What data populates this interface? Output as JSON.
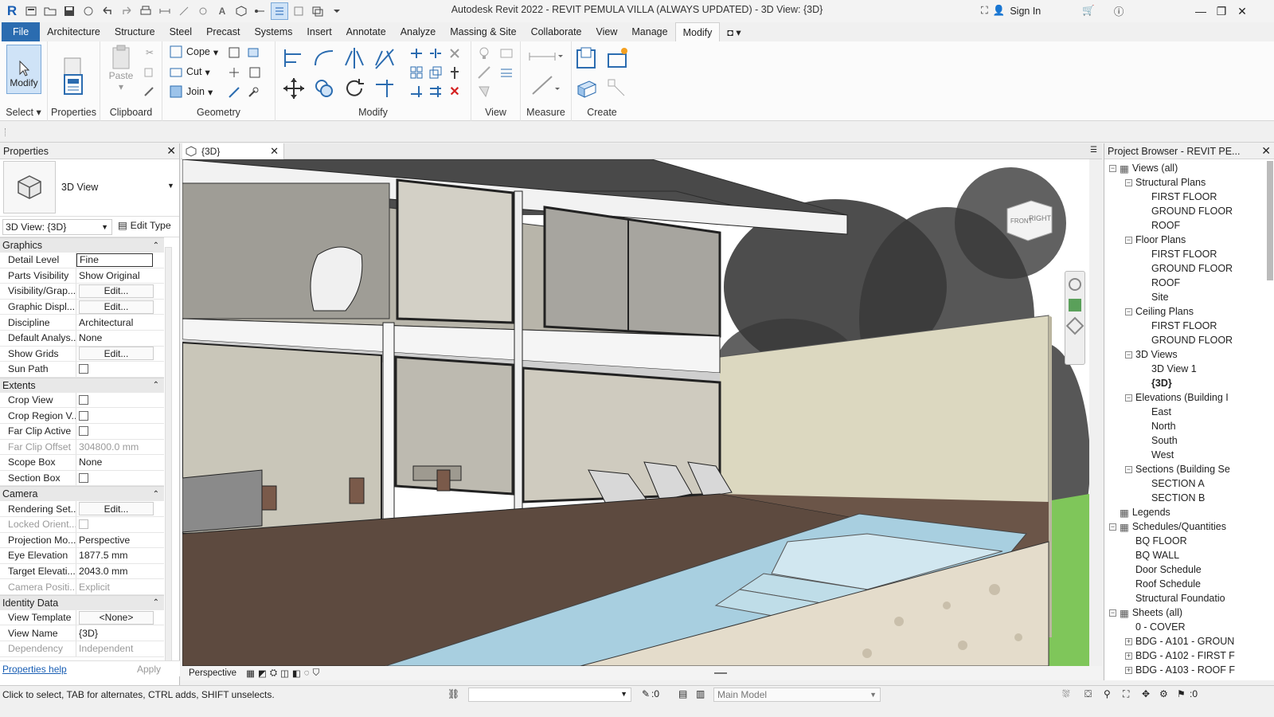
{
  "titlebar": {
    "app_title": "Autodesk Revit 2022 - REVIT PEMULA VILLA (ALWAYS UPDATED) - 3D View: {3D}",
    "sign_in": "Sign In"
  },
  "tabs": [
    "File",
    "Architecture",
    "Structure",
    "Steel",
    "Precast",
    "Systems",
    "Insert",
    "Annotate",
    "Analyze",
    "Massing & Site",
    "Collaborate",
    "View",
    "Manage",
    "Modify"
  ],
  "active_tab": "Modify",
  "ribbon": {
    "modify_label": "Modify",
    "select_label": "Select",
    "properties_label": "Properties",
    "clipboard_label": "Clipboard",
    "paste_label": "Paste",
    "geometry_label": "Geometry",
    "cope_label": "Cope",
    "cut_label": "Cut",
    "join_label": "Join",
    "modify_panel_label": "Modify",
    "view_label": "View",
    "measure_label": "Measure",
    "create_label": "Create"
  },
  "properties": {
    "title": "Properties",
    "type_name": "3D View",
    "view_selector": "3D View: {3D}",
    "edit_type": "Edit Type",
    "groups": [
      {
        "name": "Graphics",
        "rows": [
          {
            "k": "Detail Level",
            "v": "Fine",
            "kind": "input"
          },
          {
            "k": "Parts Visibility",
            "v": "Show Original"
          },
          {
            "k": "Visibility/Grap...",
            "v": "Edit...",
            "kind": "button"
          },
          {
            "k": "Graphic Displ...",
            "v": "Edit...",
            "kind": "button"
          },
          {
            "k": "Discipline",
            "v": "Architectural"
          },
          {
            "k": "Default Analys...",
            "v": "None"
          },
          {
            "k": "Show Grids",
            "v": "Edit...",
            "kind": "button"
          },
          {
            "k": "Sun Path",
            "v": "",
            "kind": "check"
          }
        ]
      },
      {
        "name": "Extents",
        "rows": [
          {
            "k": "Crop View",
            "v": "",
            "kind": "check"
          },
          {
            "k": "Crop Region V...",
            "v": "",
            "kind": "check"
          },
          {
            "k": "Far Clip Active",
            "v": "",
            "kind": "check"
          },
          {
            "k": "Far Clip Offset",
            "v": "304800.0 mm",
            "kind": "dim"
          },
          {
            "k": "Scope Box",
            "v": "None"
          },
          {
            "k": "Section Box",
            "v": "",
            "kind": "check"
          }
        ]
      },
      {
        "name": "Camera",
        "rows": [
          {
            "k": "Rendering Set...",
            "v": "Edit...",
            "kind": "button"
          },
          {
            "k": "Locked Orient...",
            "v": "",
            "kind": "dimcheck"
          },
          {
            "k": "Projection Mo...",
            "v": "Perspective"
          },
          {
            "k": "Eye Elevation",
            "v": "1877.5 mm"
          },
          {
            "k": "Target Elevati...",
            "v": "2043.0 mm"
          },
          {
            "k": "Camera Positi...",
            "v": "Explicit",
            "kind": "dim"
          }
        ]
      },
      {
        "name": "Identity Data",
        "rows": [
          {
            "k": "View Template",
            "v": "<None>",
            "kind": "button"
          },
          {
            "k": "View Name",
            "v": "{3D}"
          },
          {
            "k": "Dependency",
            "v": "Independent",
            "kind": "dim"
          }
        ]
      }
    ],
    "help_link": "Properties help",
    "apply": "Apply"
  },
  "view": {
    "tab_title": "{3D}",
    "projection": "Perspective",
    "viewcube_front": "FRONT",
    "viewcube_right": "RIGHT"
  },
  "browser": {
    "title": "Project Browser - REVIT PE...",
    "nodes": [
      {
        "label": "Views (all)",
        "level": 0,
        "exp": "-",
        "icon": true
      },
      {
        "label": "Structural Plans",
        "level": 1,
        "exp": "-"
      },
      {
        "label": "FIRST FLOOR",
        "level": 2
      },
      {
        "label": "GROUND FLOOR",
        "level": 2
      },
      {
        "label": "ROOF",
        "level": 2
      },
      {
        "label": "Floor Plans",
        "level": 1,
        "exp": "-"
      },
      {
        "label": "FIRST FLOOR",
        "level": 2
      },
      {
        "label": "GROUND FLOOR",
        "level": 2
      },
      {
        "label": "ROOF",
        "level": 2
      },
      {
        "label": "Site",
        "level": 2
      },
      {
        "label": "Ceiling Plans",
        "level": 1,
        "exp": "-"
      },
      {
        "label": "FIRST FLOOR",
        "level": 2
      },
      {
        "label": "GROUND FLOOR",
        "level": 2
      },
      {
        "label": "3D Views",
        "level": 1,
        "exp": "-"
      },
      {
        "label": "3D View 1",
        "level": 2
      },
      {
        "label": "{3D}",
        "level": 2,
        "bold": true
      },
      {
        "label": "Elevations (Building I",
        "level": 1,
        "exp": "-"
      },
      {
        "label": "East",
        "level": 2
      },
      {
        "label": "North",
        "level": 2
      },
      {
        "label": "South",
        "level": 2
      },
      {
        "label": "West",
        "level": 2
      },
      {
        "label": "Sections (Building Se",
        "level": 1,
        "exp": "-"
      },
      {
        "label": "SECTION A",
        "level": 2
      },
      {
        "label": "SECTION B",
        "level": 2
      },
      {
        "label": "Legends",
        "level": 0,
        "icon": true
      },
      {
        "label": "Schedules/Quantities",
        "level": 0,
        "exp": "-",
        "icon": true
      },
      {
        "label": "BQ FLOOR",
        "level": 1
      },
      {
        "label": "BQ WALL",
        "level": 1
      },
      {
        "label": "Door Schedule",
        "level": 1
      },
      {
        "label": "Roof Schedule",
        "level": 1
      },
      {
        "label": "Structural Foundatio",
        "level": 1
      },
      {
        "label": "Sheets (all)",
        "level": 0,
        "exp": "-",
        "icon": true
      },
      {
        "label": "0 - COVER",
        "level": 1
      },
      {
        "label": "BDG - A101 - GROUN",
        "level": 1,
        "exp": "+"
      },
      {
        "label": "BDG - A102 - FIRST F",
        "level": 1,
        "exp": "+"
      },
      {
        "label": "BDG - A103 - ROOF F",
        "level": 1,
        "exp": "+"
      }
    ]
  },
  "status": {
    "message": "Click to select, TAB for alternates, CTRL adds, SHIFT unselects.",
    "workset_count": ":0",
    "model": "Main Model",
    "filter_count": ":0"
  },
  "colors": {
    "file_tab": "#2b6cb0",
    "accent": "#2b6cb0"
  }
}
